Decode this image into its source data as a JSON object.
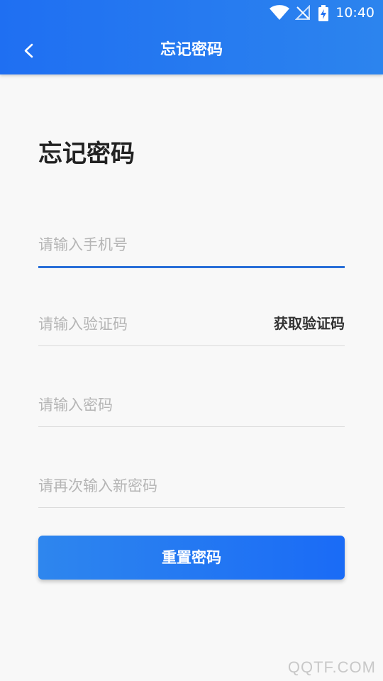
{
  "status_bar": {
    "time": "10:40",
    "icons": [
      "wifi-icon",
      "no-signal-icon",
      "battery-charging-icon"
    ]
  },
  "header": {
    "title": "忘记密码",
    "back_icon": "chevron-left-icon"
  },
  "main": {
    "heading": "忘记密码",
    "phone_placeholder": "请输入手机号",
    "code_placeholder": "请输入验证码",
    "get_code_label": "获取验证码",
    "password_placeholder": "请输入密码",
    "confirm_placeholder": "请再次输入新密码",
    "reset_label": "重置密码"
  },
  "watermark": "QQTF.COM",
  "colors": {
    "header_gradient_start": "#1f6ff2",
    "header_gradient_end": "#2c84ee",
    "active_underline": "#2a6fd8",
    "button_gradient_start": "#2e86ee",
    "button_gradient_end": "#1a6bf6",
    "background": "#f8f8f8"
  }
}
